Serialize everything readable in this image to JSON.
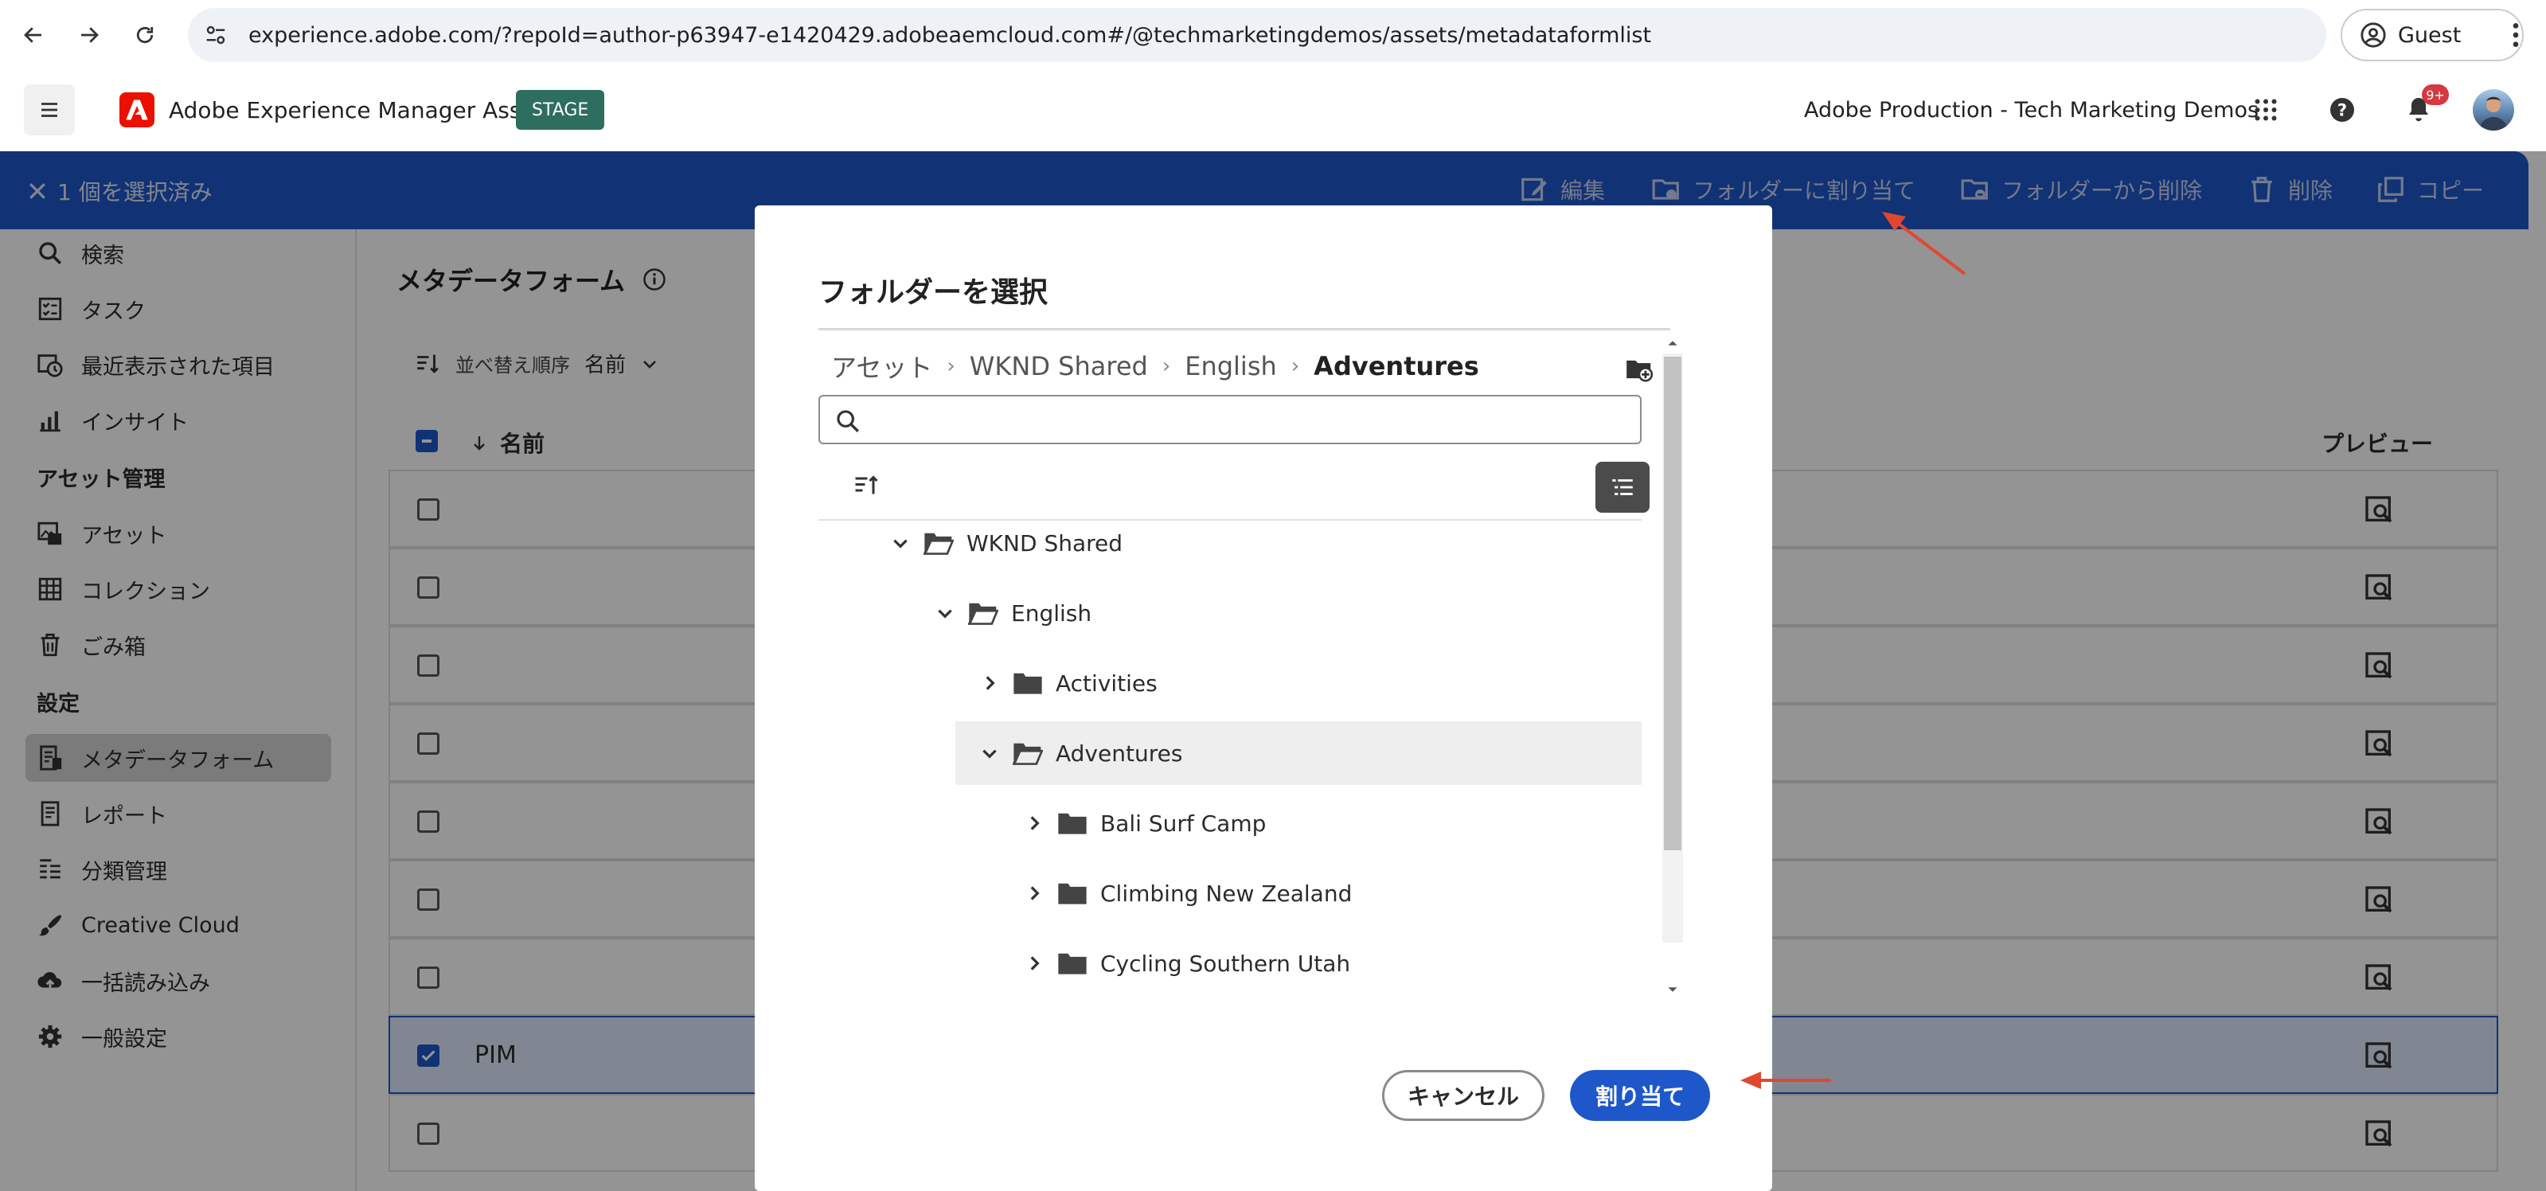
{
  "browser": {
    "url": "experience.adobe.com/?repoId=author-p63947-e1420429.adobeaemcloud.com#/@techmarketingdemos/assets/metadataformlist",
    "profile_label": "Guest"
  },
  "app": {
    "name": "Adobe Experience Manager Assets",
    "env_badge": "STAGE",
    "org": "Adobe Production - Tech Marketing Demos",
    "notification_count": "9+"
  },
  "selection_bar": {
    "count_label": "1 個を選択済み",
    "actions": {
      "edit": "編集",
      "assign_folder": "フォルダーに割り当て",
      "remove_folder": "フォルダーから削除",
      "delete": "削除",
      "copy": "コピー"
    }
  },
  "sidebar": {
    "items_top": [
      {
        "label": "検索",
        "icon": "search-icon"
      },
      {
        "label": "タスク",
        "icon": "task-icon"
      },
      {
        "label": "最近表示された項目",
        "icon": "recent-icon"
      },
      {
        "label": "インサイト",
        "icon": "insights-icon"
      }
    ],
    "section_assets": "アセット管理",
    "items_assets": [
      {
        "label": "アセット",
        "icon": "assets-icon"
      },
      {
        "label": "コレクション",
        "icon": "collection-icon"
      },
      {
        "label": "ごみ箱",
        "icon": "trash-icon"
      }
    ],
    "section_settings": "設定",
    "items_settings": [
      {
        "label": "メタデータフォーム",
        "icon": "metadata-form-icon",
        "active": true
      },
      {
        "label": "レポート",
        "icon": "report-icon"
      },
      {
        "label": "分類管理",
        "icon": "taxonomy-icon"
      },
      {
        "label": "Creative Cloud",
        "icon": "creative-cloud-icon"
      },
      {
        "label": "一括読み込み",
        "icon": "bulk-import-icon"
      },
      {
        "label": "一般設定",
        "icon": "gear-icon"
      }
    ]
  },
  "main": {
    "title": "メタデータフォーム",
    "sort_label": "並べ替え順序",
    "sort_value": "名前",
    "col_name": "名前",
    "col_preview": "プレビュー",
    "rows": [
      "",
      "",
      "",
      "",
      "",
      "",
      "",
      "PIM",
      ""
    ],
    "selected_row_index": 7
  },
  "dialog": {
    "title": "フォルダーを選択",
    "breadcrumb": [
      "アセット",
      "WKND Shared",
      "English",
      "Adventures"
    ],
    "search_placeholder": "",
    "tree": [
      {
        "label": "WKND Shared",
        "level": 0,
        "expanded": true,
        "open": true
      },
      {
        "label": "English",
        "level": 1,
        "expanded": true,
        "open": true
      },
      {
        "label": "Activities",
        "level": 2,
        "expanded": false
      },
      {
        "label": "Adventures",
        "level": 2,
        "expanded": true,
        "open": true,
        "selected": true
      },
      {
        "label": "Bali Surf Camp",
        "level": 3,
        "expanded": false
      },
      {
        "label": "Climbing New Zealand",
        "level": 3,
        "expanded": false
      },
      {
        "label": "Cycling Southern Utah",
        "level": 3,
        "expanded": false
      }
    ],
    "cancel_label": "キャンセル",
    "assign_label": "割り当て"
  },
  "colors": {
    "accent_blue": "#1e57c9",
    "stage_green": "#2d6e5f",
    "adobe_red": "#eb1000",
    "annotation_arrow": "#e0482e"
  }
}
